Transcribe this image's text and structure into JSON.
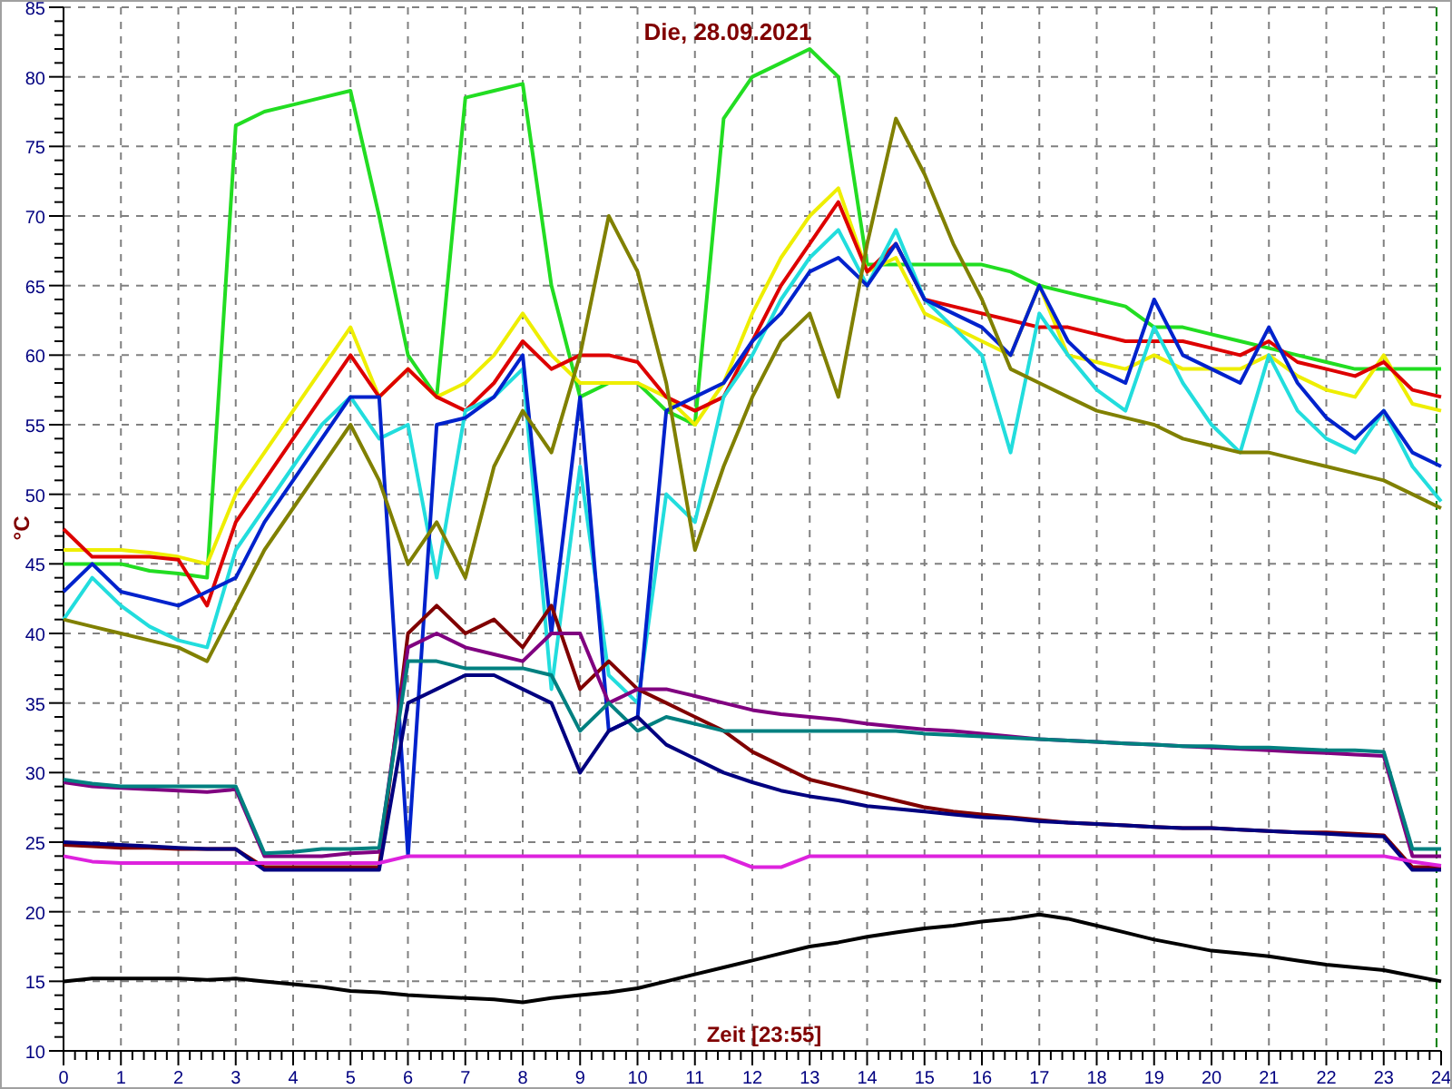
{
  "chart": {
    "chart_data": {
      "type": "line",
      "title": "Die, 28.09.2021",
      "xlabel": "Zeit [23:55]",
      "ylabel": "°C",
      "xlim": [
        0,
        24
      ],
      "ylim": [
        10,
        85
      ],
      "xticks": [
        0,
        1,
        2,
        3,
        4,
        5,
        6,
        7,
        8,
        9,
        10,
        11,
        12,
        13,
        14,
        15,
        16,
        17,
        18,
        19,
        20,
        21,
        22,
        23,
        24
      ],
      "yticks": [
        10,
        15,
        20,
        25,
        30,
        35,
        40,
        45,
        50,
        55,
        60,
        65,
        70,
        75,
        80,
        85
      ],
      "x": [
        0,
        0.5,
        1,
        1.5,
        2,
        2.5,
        3,
        3.5,
        4,
        4.5,
        5,
        5.5,
        6,
        6.5,
        7,
        7.5,
        8,
        8.5,
        9,
        9.5,
        10,
        10.5,
        11,
        11.5,
        12,
        12.5,
        13,
        13.5,
        14,
        14.5,
        15,
        15.5,
        16,
        16.5,
        17,
        17.5,
        18,
        18.5,
        19,
        19.5,
        20,
        20.5,
        21,
        21.5,
        22,
        22.5,
        23,
        23.5,
        24
      ],
      "series": [
        {
          "color": "#22dd22",
          "values": [
            45,
            45,
            45,
            44.5,
            44.3,
            44,
            76.5,
            77.5,
            78,
            78.5,
            79,
            70,
            60,
            57,
            78.5,
            79,
            79.5,
            65,
            57,
            58,
            58,
            56,
            55,
            77,
            80,
            81,
            82,
            80,
            66.5,
            66.5,
            66.5,
            66.5,
            66.5,
            66,
            65,
            64.5,
            64,
            63.5,
            62,
            62,
            61.5,
            61,
            60.5,
            60,
            59.5,
            59,
            59,
            59,
            59
          ]
        },
        {
          "color": "#eeee00",
          "values": [
            46,
            46,
            46,
            45.8,
            45.5,
            45,
            50,
            53,
            56,
            59,
            62,
            57,
            59,
            57,
            58,
            60,
            63,
            60,
            58,
            58,
            58,
            57,
            55,
            58,
            63,
            67,
            70,
            72,
            66,
            67,
            63,
            62,
            61,
            60,
            65,
            60,
            59.5,
            59,
            60,
            59,
            59,
            59,
            60,
            58.5,
            57.5,
            57,
            60,
            56.5,
            56
          ]
        },
        {
          "color": "#dd0000",
          "values": [
            47.5,
            45.5,
            45.5,
            45.5,
            45.3,
            42,
            48,
            51,
            54,
            57,
            60,
            57,
            59,
            57,
            56,
            58,
            61,
            59,
            60,
            60,
            59.5,
            57,
            56,
            57,
            61,
            65,
            68,
            71,
            66,
            68,
            64,
            63.5,
            63,
            62.5,
            62,
            62,
            61.5,
            61,
            61,
            61,
            60.5,
            60,
            61,
            59.5,
            59,
            58.5,
            59.5,
            57.5,
            57
          ]
        },
        {
          "color": "#22dddd",
          "values": [
            41,
            44,
            42,
            40.5,
            39.5,
            39,
            46,
            49,
            52,
            55,
            57,
            54,
            55,
            44,
            56,
            57,
            59,
            36,
            52,
            37,
            35,
            50,
            48,
            57,
            60,
            64,
            67,
            69,
            65,
            69,
            64,
            62,
            60,
            53,
            63,
            60,
            57.5,
            56,
            62,
            58,
            55,
            53,
            60,
            56,
            54,
            53,
            56,
            52,
            49.5
          ]
        },
        {
          "color": "#0022cc",
          "values": [
            43,
            45,
            43,
            42.5,
            42,
            43,
            44,
            48,
            51,
            54,
            57,
            57,
            24,
            55,
            55.5,
            57,
            60,
            40,
            57,
            33,
            34,
            56,
            57,
            58,
            61,
            63,
            66,
            67,
            65,
            68,
            64,
            63,
            62,
            60,
            65,
            61,
            59,
            58,
            64,
            60,
            59,
            58,
            62,
            58,
            55.5,
            54,
            56,
            53,
            52
          ]
        },
        {
          "color": "#808000",
          "values": [
            41,
            40.5,
            40,
            39.5,
            39,
            38,
            42,
            46,
            49,
            52,
            55,
            51,
            45,
            48,
            44,
            52,
            56,
            53,
            60,
            70,
            66,
            58,
            46,
            52,
            57,
            61,
            63,
            57,
            68,
            77,
            73,
            68,
            64,
            59,
            58,
            57,
            56,
            55.5,
            55,
            54,
            53.5,
            53,
            53,
            52.5,
            52,
            51.5,
            51,
            50,
            49
          ]
        },
        {
          "color": "#800000",
          "values": [
            24.8,
            24.7,
            24.6,
            24.6,
            24.5,
            24.5,
            24.5,
            23.2,
            23.2,
            23.2,
            23.2,
            23.2,
            40,
            42,
            40,
            41,
            39,
            42,
            36,
            38,
            36,
            35,
            34,
            33,
            31.5,
            30.5,
            29.5,
            29,
            28.5,
            28,
            27.5,
            27.2,
            27,
            26.8,
            26.6,
            26.4,
            26.3,
            26.2,
            26.1,
            26,
            26,
            25.9,
            25.8,
            25.7,
            25.7,
            25.6,
            25.5,
            23.2,
            23.2
          ]
        },
        {
          "color": "#800080",
          "values": [
            29.3,
            29,
            28.9,
            28.8,
            28.7,
            28.6,
            28.8,
            24,
            24,
            24,
            24.2,
            24.3,
            39,
            40,
            39,
            38.5,
            38,
            40,
            40,
            35,
            36,
            36,
            35.5,
            35,
            34.5,
            34.2,
            34,
            33.8,
            33.5,
            33.3,
            33.1,
            33,
            32.8,
            32.6,
            32.4,
            32.3,
            32.2,
            32.1,
            32,
            31.9,
            31.8,
            31.7,
            31.6,
            31.5,
            31.4,
            31.3,
            31.2,
            24,
            24
          ]
        },
        {
          "color": "#008080",
          "values": [
            29.5,
            29.2,
            29,
            29,
            29,
            29,
            29,
            24.2,
            24.3,
            24.5,
            24.5,
            24.6,
            38,
            38,
            37.5,
            37.5,
            37.5,
            37,
            33,
            35,
            33,
            34,
            33.5,
            33,
            33,
            33,
            33,
            33,
            33,
            33,
            32.8,
            32.7,
            32.6,
            32.5,
            32.4,
            32.3,
            32.2,
            32.1,
            32,
            31.9,
            31.9,
            31.8,
            31.8,
            31.7,
            31.6,
            31.6,
            31.5,
            24.5,
            24.5
          ]
        },
        {
          "color": "#000080",
          "values": [
            25,
            24.9,
            24.8,
            24.7,
            24.6,
            24.5,
            24.5,
            23,
            23,
            23,
            23,
            23,
            35,
            36,
            37,
            37,
            36,
            35,
            30,
            33,
            34,
            32,
            31,
            30,
            29.3,
            28.7,
            28.3,
            28,
            27.6,
            27.4,
            27.2,
            27,
            26.8,
            26.7,
            26.5,
            26.4,
            26.3,
            26.2,
            26.1,
            26,
            26,
            25.9,
            25.8,
            25.7,
            25.6,
            25.5,
            25.4,
            23,
            23
          ]
        },
        {
          "color": "#dd22dd",
          "values": [
            24,
            23.6,
            23.5,
            23.5,
            23.5,
            23.5,
            23.5,
            23.5,
            23.5,
            23.5,
            23.5,
            23.5,
            24,
            24,
            24,
            24,
            24,
            24,
            24,
            24,
            24,
            24,
            24,
            24,
            23.2,
            23.2,
            24,
            24,
            24,
            24,
            24,
            24,
            24,
            24,
            24,
            24,
            24,
            24,
            24,
            24,
            24,
            24,
            24,
            24,
            24,
            24,
            24,
            23.6,
            23.3
          ]
        },
        {
          "color": "#000000",
          "values": [
            15,
            15.2,
            15.2,
            15.2,
            15.2,
            15.1,
            15.2,
            15,
            14.8,
            14.6,
            14.3,
            14.2,
            14,
            13.9,
            13.8,
            13.7,
            13.5,
            13.8,
            14,
            14.2,
            14.5,
            15,
            15.5,
            16,
            16.5,
            17,
            17.5,
            17.8,
            18.2,
            18.5,
            18.8,
            19,
            19.3,
            19.5,
            19.8,
            19.5,
            19,
            18.5,
            18,
            17.6,
            17.2,
            17,
            16.8,
            16.5,
            16.2,
            16,
            15.8,
            15.4,
            15
          ]
        }
      ],
      "grid": true,
      "ref_lines": [
        {
          "axis": "x",
          "value": 23.92,
          "color": "#008000"
        }
      ]
    }
  }
}
